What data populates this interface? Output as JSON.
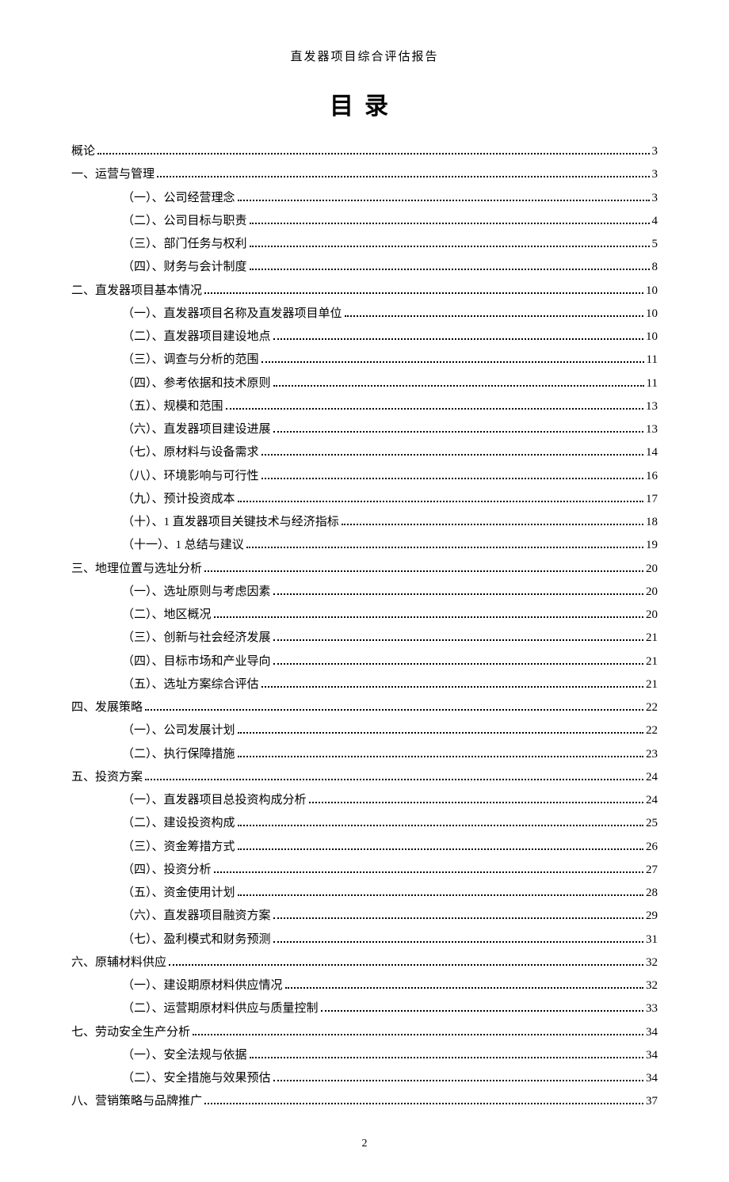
{
  "header": "直发器项目综合评估报告",
  "title": "目录",
  "pageNumber": "2",
  "entries": [
    {
      "indent": 0,
      "label": "概论",
      "page": "3"
    },
    {
      "indent": 0,
      "label": "一、运营与管理",
      "page": "3"
    },
    {
      "indent": 1,
      "label": "（一）、公司经营理念",
      "page": "3"
    },
    {
      "indent": 1,
      "label": "（二）、公司目标与职责",
      "page": "4"
    },
    {
      "indent": 1,
      "label": "（三）、部门任务与权利",
      "page": "5"
    },
    {
      "indent": 1,
      "label": "（四）、财务与会计制度",
      "page": "8"
    },
    {
      "indent": 0,
      "label": "二、直发器项目基本情况",
      "page": "10"
    },
    {
      "indent": 1,
      "label": "（一）、直发器项目名称及直发器项目单位",
      "page": "10"
    },
    {
      "indent": 1,
      "label": "（二）、直发器项目建设地点",
      "page": "10"
    },
    {
      "indent": 1,
      "label": "（三）、调查与分析的范围",
      "page": "11"
    },
    {
      "indent": 1,
      "label": "（四）、参考依据和技术原则",
      "page": "11"
    },
    {
      "indent": 1,
      "label": "（五）、规模和范围",
      "page": "13"
    },
    {
      "indent": 1,
      "label": "（六）、直发器项目建设进展",
      "page": "13"
    },
    {
      "indent": 1,
      "label": "（七）、原材料与设备需求",
      "page": "14"
    },
    {
      "indent": 1,
      "label": "（八）、环境影响与可行性",
      "page": "16"
    },
    {
      "indent": 1,
      "label": "（九）、预计投资成本",
      "page": "17"
    },
    {
      "indent": 1,
      "label": "（十）、1 直发器项目关键技术与经济指标",
      "page": "18"
    },
    {
      "indent": 1,
      "label": "（十一）、1 总结与建议",
      "page": "19"
    },
    {
      "indent": 0,
      "label": "三、地理位置与选址分析",
      "page": "20"
    },
    {
      "indent": 1,
      "label": "（一）、选址原则与考虑因素",
      "page": "20"
    },
    {
      "indent": 1,
      "label": "（二）、地区概况",
      "page": "20"
    },
    {
      "indent": 1,
      "label": "（三）、创新与社会经济发展",
      "page": "21"
    },
    {
      "indent": 1,
      "label": "（四）、目标市场和产业导向",
      "page": "21"
    },
    {
      "indent": 1,
      "label": "（五）、选址方案综合评估",
      "page": "21"
    },
    {
      "indent": 0,
      "label": "四、发展策略",
      "page": "22"
    },
    {
      "indent": 1,
      "label": "（一）、公司发展计划",
      "page": "22"
    },
    {
      "indent": 1,
      "label": "（二）、执行保障措施",
      "page": "23"
    },
    {
      "indent": 0,
      "label": "五、投资方案",
      "page": "24"
    },
    {
      "indent": 1,
      "label": "（一）、直发器项目总投资构成分析",
      "page": "24"
    },
    {
      "indent": 1,
      "label": "（二）、建设投资构成",
      "page": "25"
    },
    {
      "indent": 1,
      "label": "（三）、资金筹措方式",
      "page": "26"
    },
    {
      "indent": 1,
      "label": "（四）、投资分析",
      "page": "27"
    },
    {
      "indent": 1,
      "label": "（五）、资金使用计划",
      "page": "28"
    },
    {
      "indent": 1,
      "label": "（六）、直发器项目融资方案",
      "page": "29"
    },
    {
      "indent": 1,
      "label": "（七）、盈利模式和财务预测",
      "page": "31"
    },
    {
      "indent": 0,
      "label": "六、原辅材料供应",
      "page": "32"
    },
    {
      "indent": 1,
      "label": "（一）、建设期原材料供应情况",
      "page": "32"
    },
    {
      "indent": 1,
      "label": "（二）、运营期原材料供应与质量控制",
      "page": "33"
    },
    {
      "indent": 0,
      "label": "七、劳动安全生产分析",
      "page": "34"
    },
    {
      "indent": 1,
      "label": "（一）、安全法规与依据",
      "page": "34"
    },
    {
      "indent": 1,
      "label": "（二）、安全措施与效果预估",
      "page": "34"
    },
    {
      "indent": 0,
      "label": "八、营销策略与品牌推广",
      "page": "37"
    }
  ]
}
